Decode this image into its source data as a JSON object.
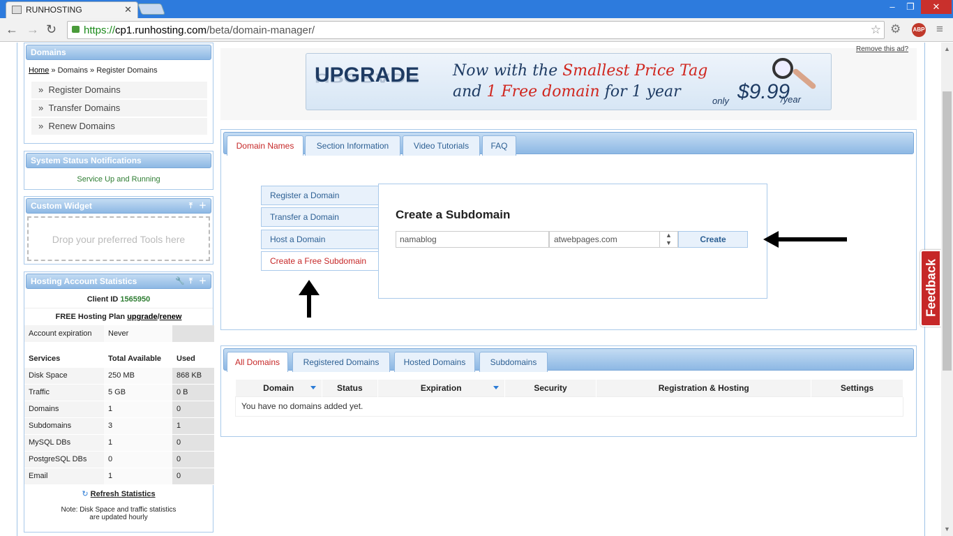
{
  "browser": {
    "tab_title": "RUNHOSTING",
    "url_scheme": "https://",
    "url_host": "cp1.runhosting.com",
    "url_path": "/beta/domain-manager/",
    "abp_label": "ABP"
  },
  "sidebar": {
    "domains_title": "Domains",
    "breadcrumb": {
      "home": "Home",
      "sep1": " » Domains » Register Domains"
    },
    "nav_items": [
      "Register Domains",
      "Transfer Domains",
      "Renew Domains"
    ],
    "status_title": "System Status Notifications",
    "status_text": "Service Up and Running",
    "widget_title": "Custom Widget",
    "widget_placeholder": "Drop your preferred Tools here",
    "stats_title": "Hosting Account Statistics",
    "client_label": "Client ID",
    "client_id": "1565950",
    "plan_label": "FREE Hosting Plan",
    "plan_upgrade": "upgrade",
    "plan_renew": "renew",
    "expiration_label": "Account expiration",
    "expiration_value": "Never",
    "stats_headers": [
      "Services",
      "Total Available",
      "Used"
    ],
    "stats_rows": [
      [
        "Disk Space",
        "250 MB",
        "868 KB"
      ],
      [
        "Traffic",
        "5 GB",
        "0 B"
      ],
      [
        "Domains",
        "1",
        "0"
      ],
      [
        "Subdomains",
        "3",
        "1"
      ],
      [
        "MySQL DBs",
        "1",
        "0"
      ],
      [
        "PostgreSQL DBs",
        "0",
        "0"
      ],
      [
        "Email",
        "1",
        "0"
      ]
    ],
    "refresh_label": "Refresh Statistics",
    "note_line1": "Note: Disk Space and traffic statistics",
    "note_line2": "are updated hourly"
  },
  "ad": {
    "remove_label": "Remove this ad?",
    "upgrade": "UPGRADE",
    "line1_a": "Now with the ",
    "line1_b": "Smallest Price Tag",
    "line2_a": "and ",
    "line2_b": "1 Free domain",
    "line2_c": " for 1 year",
    "only": "only",
    "price": "$9.99",
    "per_year": "/year"
  },
  "main_tabs": [
    "Domain Names",
    "Section Information",
    "Video Tutorials",
    "FAQ"
  ],
  "side_tabs": [
    "Register a Domain",
    "Transfer a Domain",
    "Host a Domain",
    "Create a Free Subdomain"
  ],
  "create": {
    "title": "Create a Subdomain",
    "input_value": "namablog",
    "select_value": "atwebpages.com",
    "button": "Create"
  },
  "domain_tabs": [
    "All Domains",
    "Registered Domains",
    "Hosted Domains",
    "Subdomains"
  ],
  "domain_table": {
    "headers": [
      "Domain",
      "Status",
      "Expiration",
      "Security",
      "Registration & Hosting",
      "Settings"
    ],
    "empty": "You have no domains added yet."
  },
  "feedback_label": "Feedback",
  "colors": {
    "accent": "#2b7bd6",
    "active_tab": "#c62828",
    "status_green": "#2e7d32"
  }
}
